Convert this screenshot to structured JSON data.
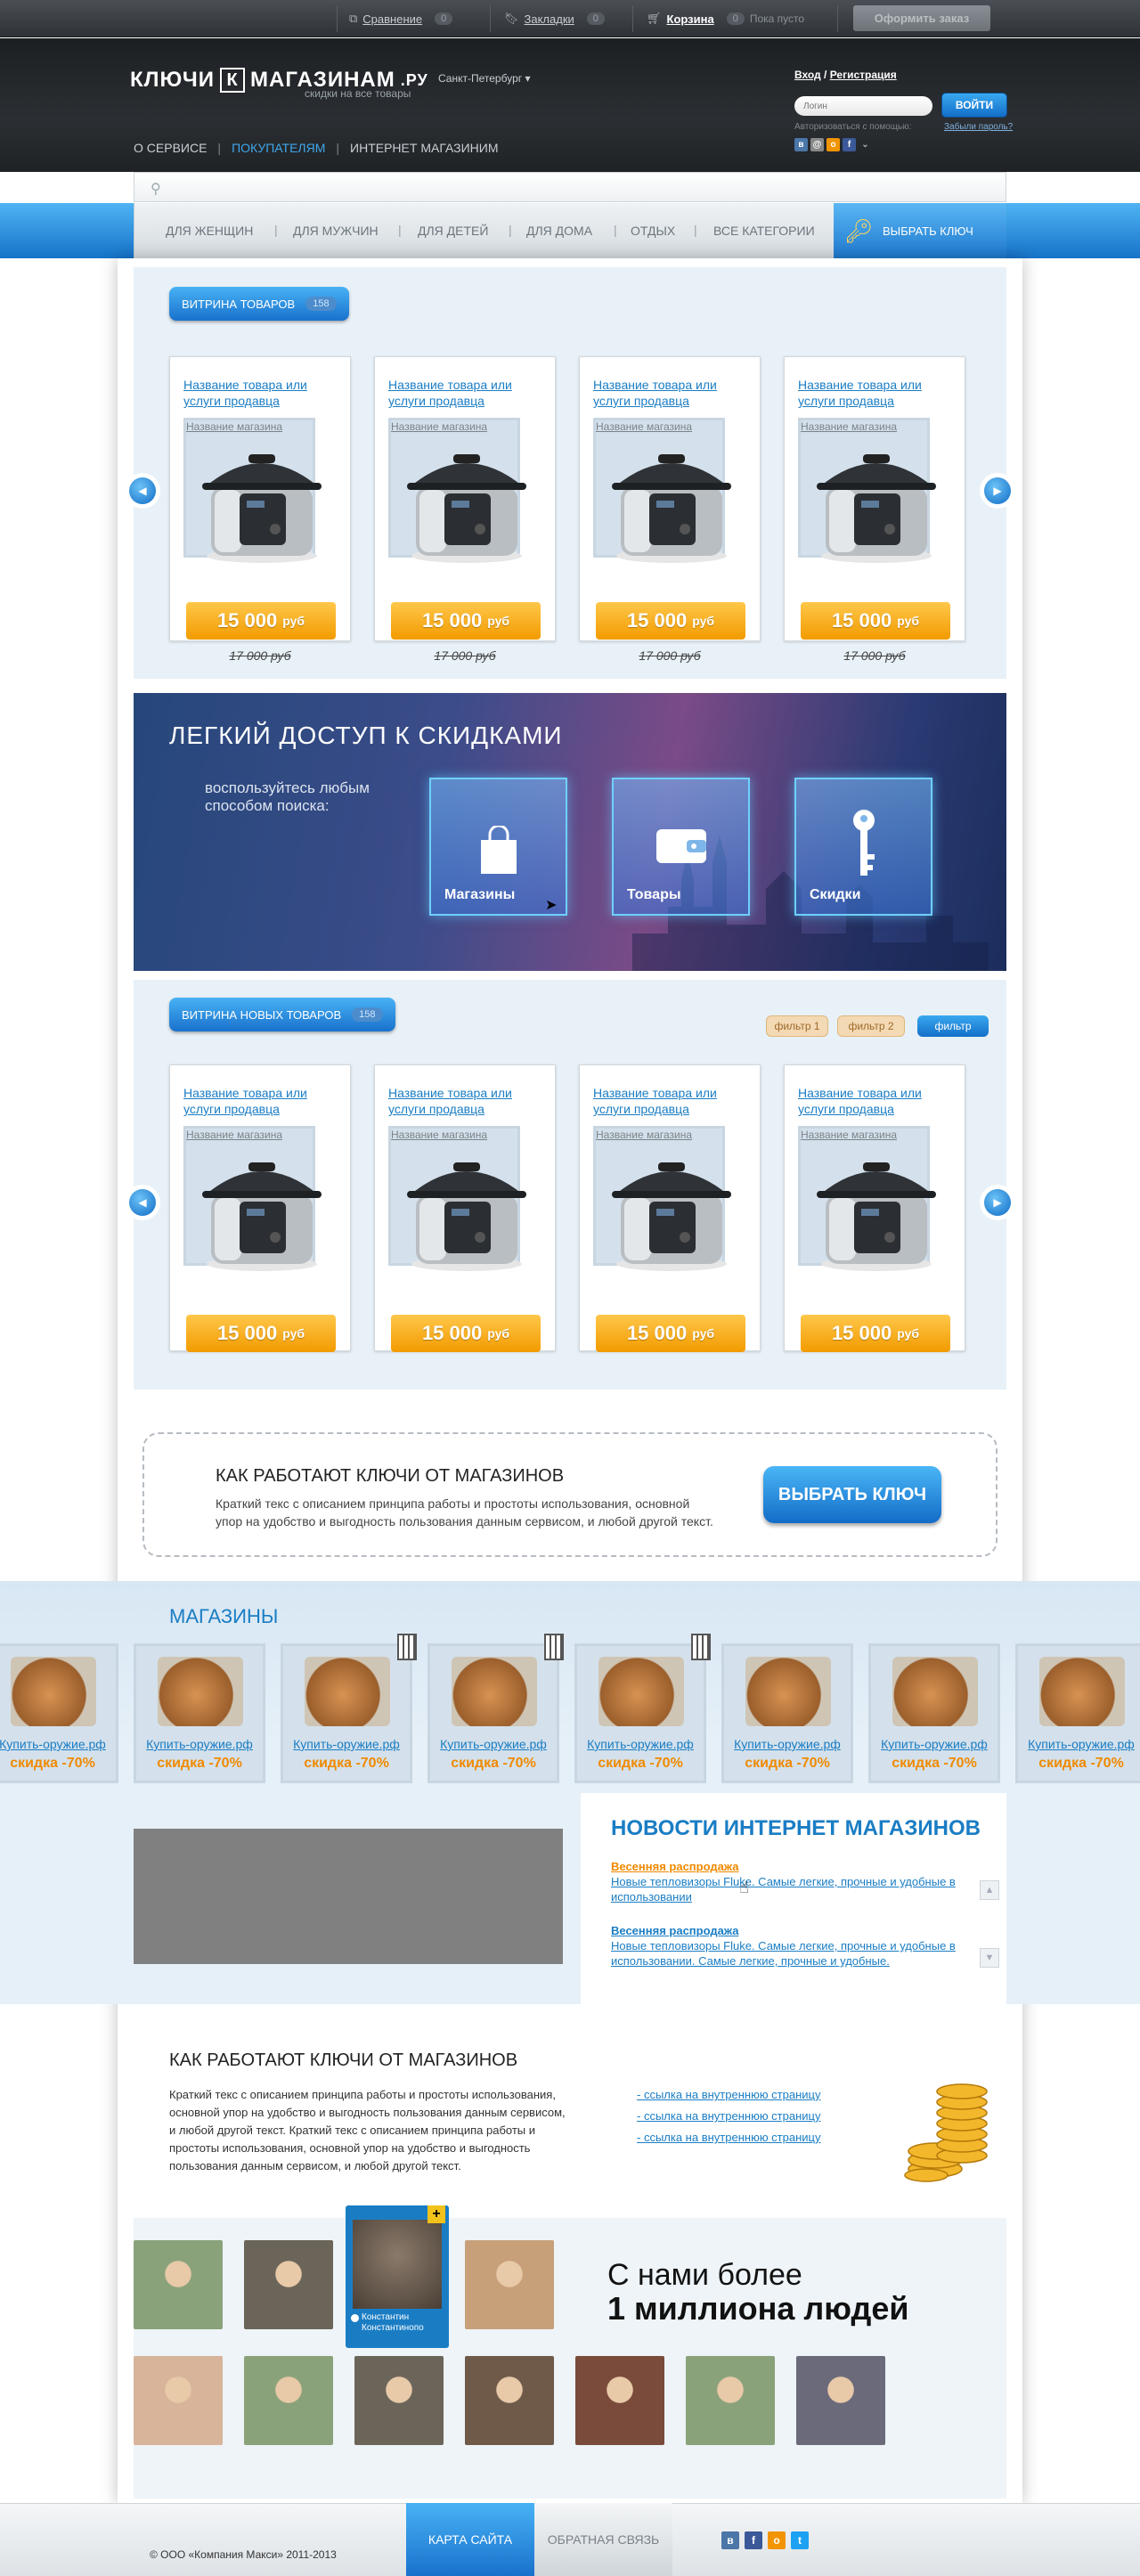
{
  "topbar": {
    "compare": "Сравнение",
    "compare_count": "0",
    "bookmarks": "Закладки",
    "bookmarks_count": "0",
    "cart": "Корзина",
    "cart_count": "0",
    "cart_status": "Пока пусто",
    "order_button": "Оформить заказ"
  },
  "header": {
    "logo_left": "КЛЮЧИ",
    "logo_k": "К",
    "logo_right": "МАГАЗИНАМ",
    "logo_tld": ".РУ",
    "tagline": "скидки на все товары",
    "city": "Санкт-Петербург ▾",
    "nav": [
      "О СЕРВИСЕ",
      "ПОКУПАТЕЛЯМ",
      "ИНТЕРНЕТ МАГАЗИНИМ"
    ]
  },
  "login": {
    "login_link": "Вход",
    "slash": " / ",
    "register_link": "Регистрация",
    "login_placeholder": "Логин",
    "submit": "ВОЙТИ",
    "via": "Авторизоваться с помощью:",
    "forgot": "Забыли пароль?"
  },
  "categories": {
    "items": [
      "ДЛЯ ЖЕНЩИН",
      "ДЛЯ МУЖЧИН",
      "ДЛЯ ДЕТЕЙ",
      "ДЛЯ ДОМА",
      "ОТДЫХ",
      "ВСЕ КАТЕГОРИИ"
    ],
    "pick_key": "ВЫБРАТЬ КЛЮЧ"
  },
  "showcase": {
    "title": "ВИТРИНА ТОВАРОВ",
    "count": "158",
    "products": [
      {
        "title": "Название товара или услуги продавца",
        "shop": "Название магазина",
        "price": "15 000",
        "currency": "руб",
        "old_price": "17 000 руб"
      },
      {
        "title": "Название товара или услуги продавца",
        "shop": "Название магазина",
        "price": "15 000",
        "currency": "руб",
        "old_price": "17 000 руб"
      },
      {
        "title": "Название товара или услуги продавца",
        "shop": "Название магазина",
        "price": "15 000",
        "currency": "руб",
        "old_price": "17 000 руб"
      },
      {
        "title": "Название товара или услуги продавца",
        "shop": "Название магазина",
        "price": "15 000",
        "currency": "руб",
        "old_price": "17 000 руб"
      }
    ]
  },
  "promo": {
    "title": "ЛЕГКИЙ ДОСТУП К СКИДКАМИ",
    "text": "воспользуйтесь любым способом поиска:",
    "tiles": [
      "Магазины",
      "Товары",
      "Скидки"
    ]
  },
  "new_showcase": {
    "title": "ВИТРИНА НОВЫХ ТОВАРОВ",
    "count": "158",
    "filters": [
      "фильтр 1",
      "фильтр 2",
      "фильтр"
    ],
    "products": [
      {
        "title": "Название товара или услуги продавца",
        "shop": "Название магазина",
        "price": "15 000",
        "currency": "руб"
      },
      {
        "title": "Название товара или услуги продавца",
        "shop": "Название магазина",
        "price": "15 000",
        "currency": "руб"
      },
      {
        "title": "Название товара или услуги продавца",
        "shop": "Название магазина",
        "price": "15 000",
        "currency": "руб"
      },
      {
        "title": "Название товара или услуги продавца",
        "shop": "Название магазина",
        "price": "15 000",
        "currency": "руб"
      }
    ]
  },
  "how": {
    "title": "КАК РАБОТАЮТ КЛЮЧИ ОТ МАГАЗИНОВ",
    "text": "Краткий текс с описанием принципа работы и простоты использования, основной упор на удобство и выгодность пользования данным сервисом, и любой другой текст.",
    "button": "ВЫБРАТЬ КЛЮЧ"
  },
  "shops": {
    "title": "МАГАЗИНЫ",
    "items": [
      {
        "name": "Купить-оружие.рф",
        "discount": "скидка -70%"
      },
      {
        "name": "Купить-оружие.рф",
        "discount": "скидка -70%"
      },
      {
        "name": "Купить-оружие.рф",
        "discount": "скидка -70%"
      },
      {
        "name": "Купить-оружие.рф",
        "discount": "скидка -70%"
      },
      {
        "name": "Купить-оружие.рф",
        "discount": "скидка -70%"
      },
      {
        "name": "Купить-оружие.рф",
        "discount": "скидка -70%"
      },
      {
        "name": "Купить-оружие.рф",
        "discount": "скидка -70%"
      },
      {
        "name": "Купить-оружие.рф",
        "discount": "скидка -70%"
      }
    ]
  },
  "news": {
    "title": "НОВОСТИ ИНТЕРНЕТ МАГАЗИНОВ",
    "items": [
      {
        "head": "Весенняя распродажа",
        "body": "Новые тепловизоры Fluke. Самые легкие, прочные и удобные в использовании"
      },
      {
        "head": "Весенняя распродажа",
        "body": "Новые тепловизоры Fluke. Самые легкие, прочные и удобные в использовании. Самые легкие, прочные и удобные."
      }
    ]
  },
  "about": {
    "title": "КАК РАБОТАЮТ КЛЮЧИ ОТ МАГАЗИНОВ",
    "text": "Краткий текс с описанием принципа работы и простоты использования, основной упор на удобство и выгодность пользования данным сервисом, и любой другой текст. Краткий текс с описанием принципа работы и простоты использования, основной упор на удобство и выгодность пользования данным сервисом, и любой другой текст.",
    "links": [
      "- ссылка на внутреннюю страницу",
      "- ссылка на внутреннюю страницу",
      "- ссылка на внутреннюю страницу"
    ]
  },
  "people": {
    "line1": "С нами более",
    "line2": "1 миллиона людей",
    "highlight_name": "Константин Константинопо",
    "plus": "+"
  },
  "footer": {
    "copyright": "© ООО «Компания Макси» 2011-2013",
    "sitemap": "КАРТА САЙТА",
    "feedback": "ОБРАТНАЯ СВЯЗЬ"
  },
  "colors": {
    "accent": "#1a7dc4",
    "price": "#f29b00",
    "discount": "#f08a00"
  }
}
